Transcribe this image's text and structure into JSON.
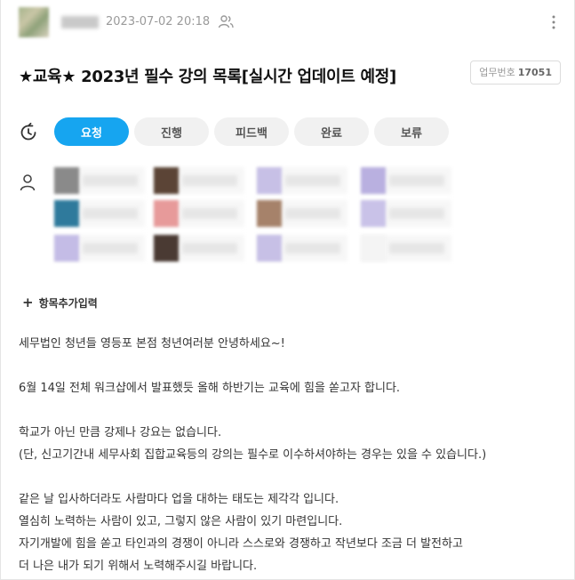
{
  "post": {
    "date": "2023-07-02 20:18",
    "title": "★교육★ 2023년 필수 강의 목록[실시간 업데이트 예정]",
    "task_number_label": "업무번호",
    "task_number": "17051"
  },
  "status": {
    "tabs": [
      {
        "label": "요청",
        "active": true
      },
      {
        "label": "진행",
        "active": false
      },
      {
        "label": "피드백",
        "active": false
      },
      {
        "label": "완료",
        "active": false
      },
      {
        "label": "보류",
        "active": false
      }
    ]
  },
  "assignees": {
    "count": 12,
    "avatar_colors": [
      "#8a8a8a",
      "#5b4436",
      "#c7c0e6",
      "#b9b0e0",
      "#2f7a9c",
      "#e79a9a",
      "#a6826a",
      "#c9c2e8",
      "#c4bce6",
      "#4a3a33",
      "#c7c0e6",
      "#f4f4f4"
    ]
  },
  "add_item": {
    "label": "항목추가입력"
  },
  "body": {
    "lines": [
      "세무법인 청년들 영등포 본점 청년여러분 안녕하세요~!",
      "",
      "6월 14일 전체 워크샵에서 발표했듯 올해 하반기는 교육에 힘을 쏟고자 합니다.",
      "",
      "학교가 아닌 만큼 강제나 강요는 없습니다.",
      "(단, 신고기간내 세무사회 집합교육등의 강의는 필수로 이수하셔야하는 경우는 있을 수 있습니다.)",
      "",
      "같은 날 입사하더라도 사람마다 업을 대하는 태도는 제각각 입니다.",
      "열심히 노력하는 사람이 있고, 그렇지 않은 사람이 있기 마련입니다.",
      "자기개발에 힘을 쏟고 타인과의 경쟁이 아니라 스스로와 경쟁하고 작년보다 조금 더 발전하고",
      "더 나은 내가 되기 위해서 노력해주시길 바랍니다."
    ]
  },
  "icons": {
    "share": "people-share-icon",
    "more": "more-vertical-icon",
    "status": "status-cycle-icon",
    "assignee": "person-icon",
    "add": "plus-icon"
  },
  "colors": {
    "accent": "#16a5f0"
  }
}
